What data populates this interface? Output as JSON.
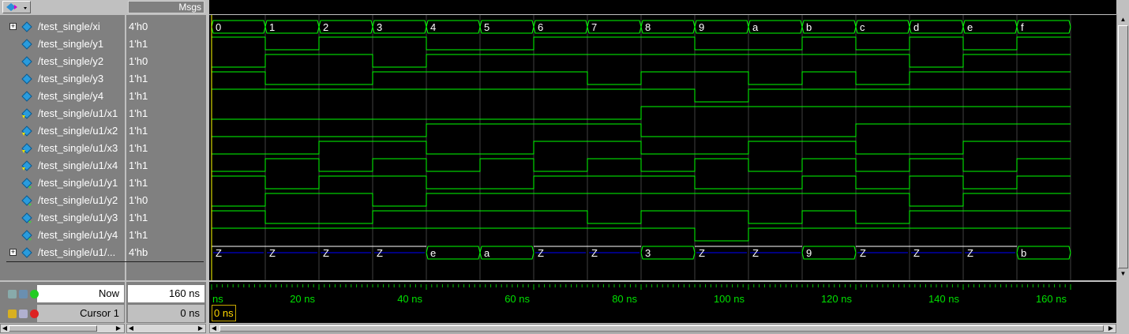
{
  "header": {
    "msgs_label": "Msgs"
  },
  "signals": [
    {
      "name": "/test_single/xi",
      "value": "4'h0",
      "expandable": true,
      "kind": "bus"
    },
    {
      "name": "/test_single/y1",
      "value": "1'h1",
      "expandable": false,
      "kind": "bit"
    },
    {
      "name": "/test_single/y2",
      "value": "1'h0",
      "expandable": false,
      "kind": "bit"
    },
    {
      "name": "/test_single/y3",
      "value": "1'h1",
      "expandable": false,
      "kind": "bit"
    },
    {
      "name": "/test_single/y4",
      "value": "1'h1",
      "expandable": false,
      "kind": "bit"
    },
    {
      "name": "/test_single/u1/x1",
      "value": "1'h1",
      "expandable": false,
      "kind": "input"
    },
    {
      "name": "/test_single/u1/x2",
      "value": "1'h1",
      "expandable": false,
      "kind": "input"
    },
    {
      "name": "/test_single/u1/x3",
      "value": "1'h1",
      "expandable": false,
      "kind": "input"
    },
    {
      "name": "/test_single/u1/x4",
      "value": "1'h1",
      "expandable": false,
      "kind": "input"
    },
    {
      "name": "/test_single/u1/y1",
      "value": "1'h1",
      "expandable": false,
      "kind": "output"
    },
    {
      "name": "/test_single/u1/y2",
      "value": "1'h0",
      "expandable": false,
      "kind": "output"
    },
    {
      "name": "/test_single/u1/y3",
      "value": "1'h1",
      "expandable": false,
      "kind": "output"
    },
    {
      "name": "/test_single/u1/y4",
      "value": "1'h1",
      "expandable": false,
      "kind": "output"
    },
    {
      "name": "/test_single/u1/...",
      "value": "4'hb",
      "expandable": true,
      "kind": "bus"
    }
  ],
  "waves": {
    "xi": [
      "0",
      "1",
      "2",
      "3",
      "4",
      "5",
      "6",
      "7",
      "8",
      "9",
      "a",
      "b",
      "c",
      "d",
      "e",
      "f"
    ],
    "y1": [
      1,
      0,
      1,
      1,
      0,
      0,
      1,
      1,
      1,
      0,
      0,
      1,
      0,
      1,
      0,
      1
    ],
    "y2": [
      0,
      1,
      1,
      0,
      1,
      1,
      1,
      1,
      1,
      1,
      1,
      1,
      1,
      0,
      1,
      1
    ],
    "y3": [
      1,
      0,
      0,
      1,
      1,
      1,
      1,
      0,
      1,
      1,
      0,
      1,
      0,
      1,
      1,
      1
    ],
    "y4": [
      1,
      1,
      1,
      1,
      1,
      1,
      1,
      1,
      1,
      0,
      1,
      1,
      1,
      1,
      1,
      1
    ],
    "x1": [
      0,
      0,
      0,
      0,
      0,
      0,
      0,
      0,
      1,
      1,
      1,
      1,
      1,
      1,
      1,
      1
    ],
    "x2": [
      0,
      0,
      0,
      0,
      1,
      1,
      1,
      1,
      0,
      0,
      0,
      0,
      1,
      1,
      1,
      1
    ],
    "x3": [
      0,
      0,
      1,
      1,
      0,
      0,
      1,
      1,
      0,
      0,
      1,
      1,
      0,
      0,
      1,
      1
    ],
    "x4": [
      0,
      1,
      0,
      1,
      0,
      1,
      0,
      1,
      0,
      1,
      0,
      1,
      0,
      1,
      0,
      1
    ],
    "u1y1": [
      1,
      0,
      1,
      1,
      0,
      0,
      1,
      1,
      1,
      0,
      0,
      1,
      0,
      1,
      0,
      1
    ],
    "u1y2": [
      0,
      1,
      1,
      0,
      1,
      1,
      1,
      1,
      1,
      1,
      1,
      1,
      1,
      0,
      1,
      1
    ],
    "u1y3": [
      1,
      0,
      0,
      1,
      1,
      1,
      1,
      0,
      1,
      1,
      0,
      1,
      0,
      1,
      1,
      1
    ],
    "u1y4": [
      1,
      1,
      1,
      1,
      1,
      1,
      1,
      1,
      1,
      0,
      1,
      1,
      1,
      1,
      1,
      1
    ],
    "bus2": [
      "Z",
      "Z",
      "Z",
      "Z",
      "e",
      "a",
      "Z",
      "Z",
      "3",
      "Z",
      "Z",
      "9",
      "Z",
      "Z",
      "Z",
      "b"
    ]
  },
  "colors": {
    "high": "#00ff00",
    "mid": "#0000ff",
    "grid": "#404040",
    "cursor": "#ffff00"
  },
  "status": {
    "now_label": "Now",
    "now_value": "160 ns",
    "cursor_label": "Cursor 1",
    "cursor_value": "0 ns",
    "cursor_readout": "0 ns"
  },
  "timeline": {
    "ticks": [
      "ns",
      "20 ns",
      "40 ns",
      "60 ns",
      "80 ns",
      "100 ns",
      "120 ns",
      "140 ns",
      "160 ns"
    ]
  }
}
